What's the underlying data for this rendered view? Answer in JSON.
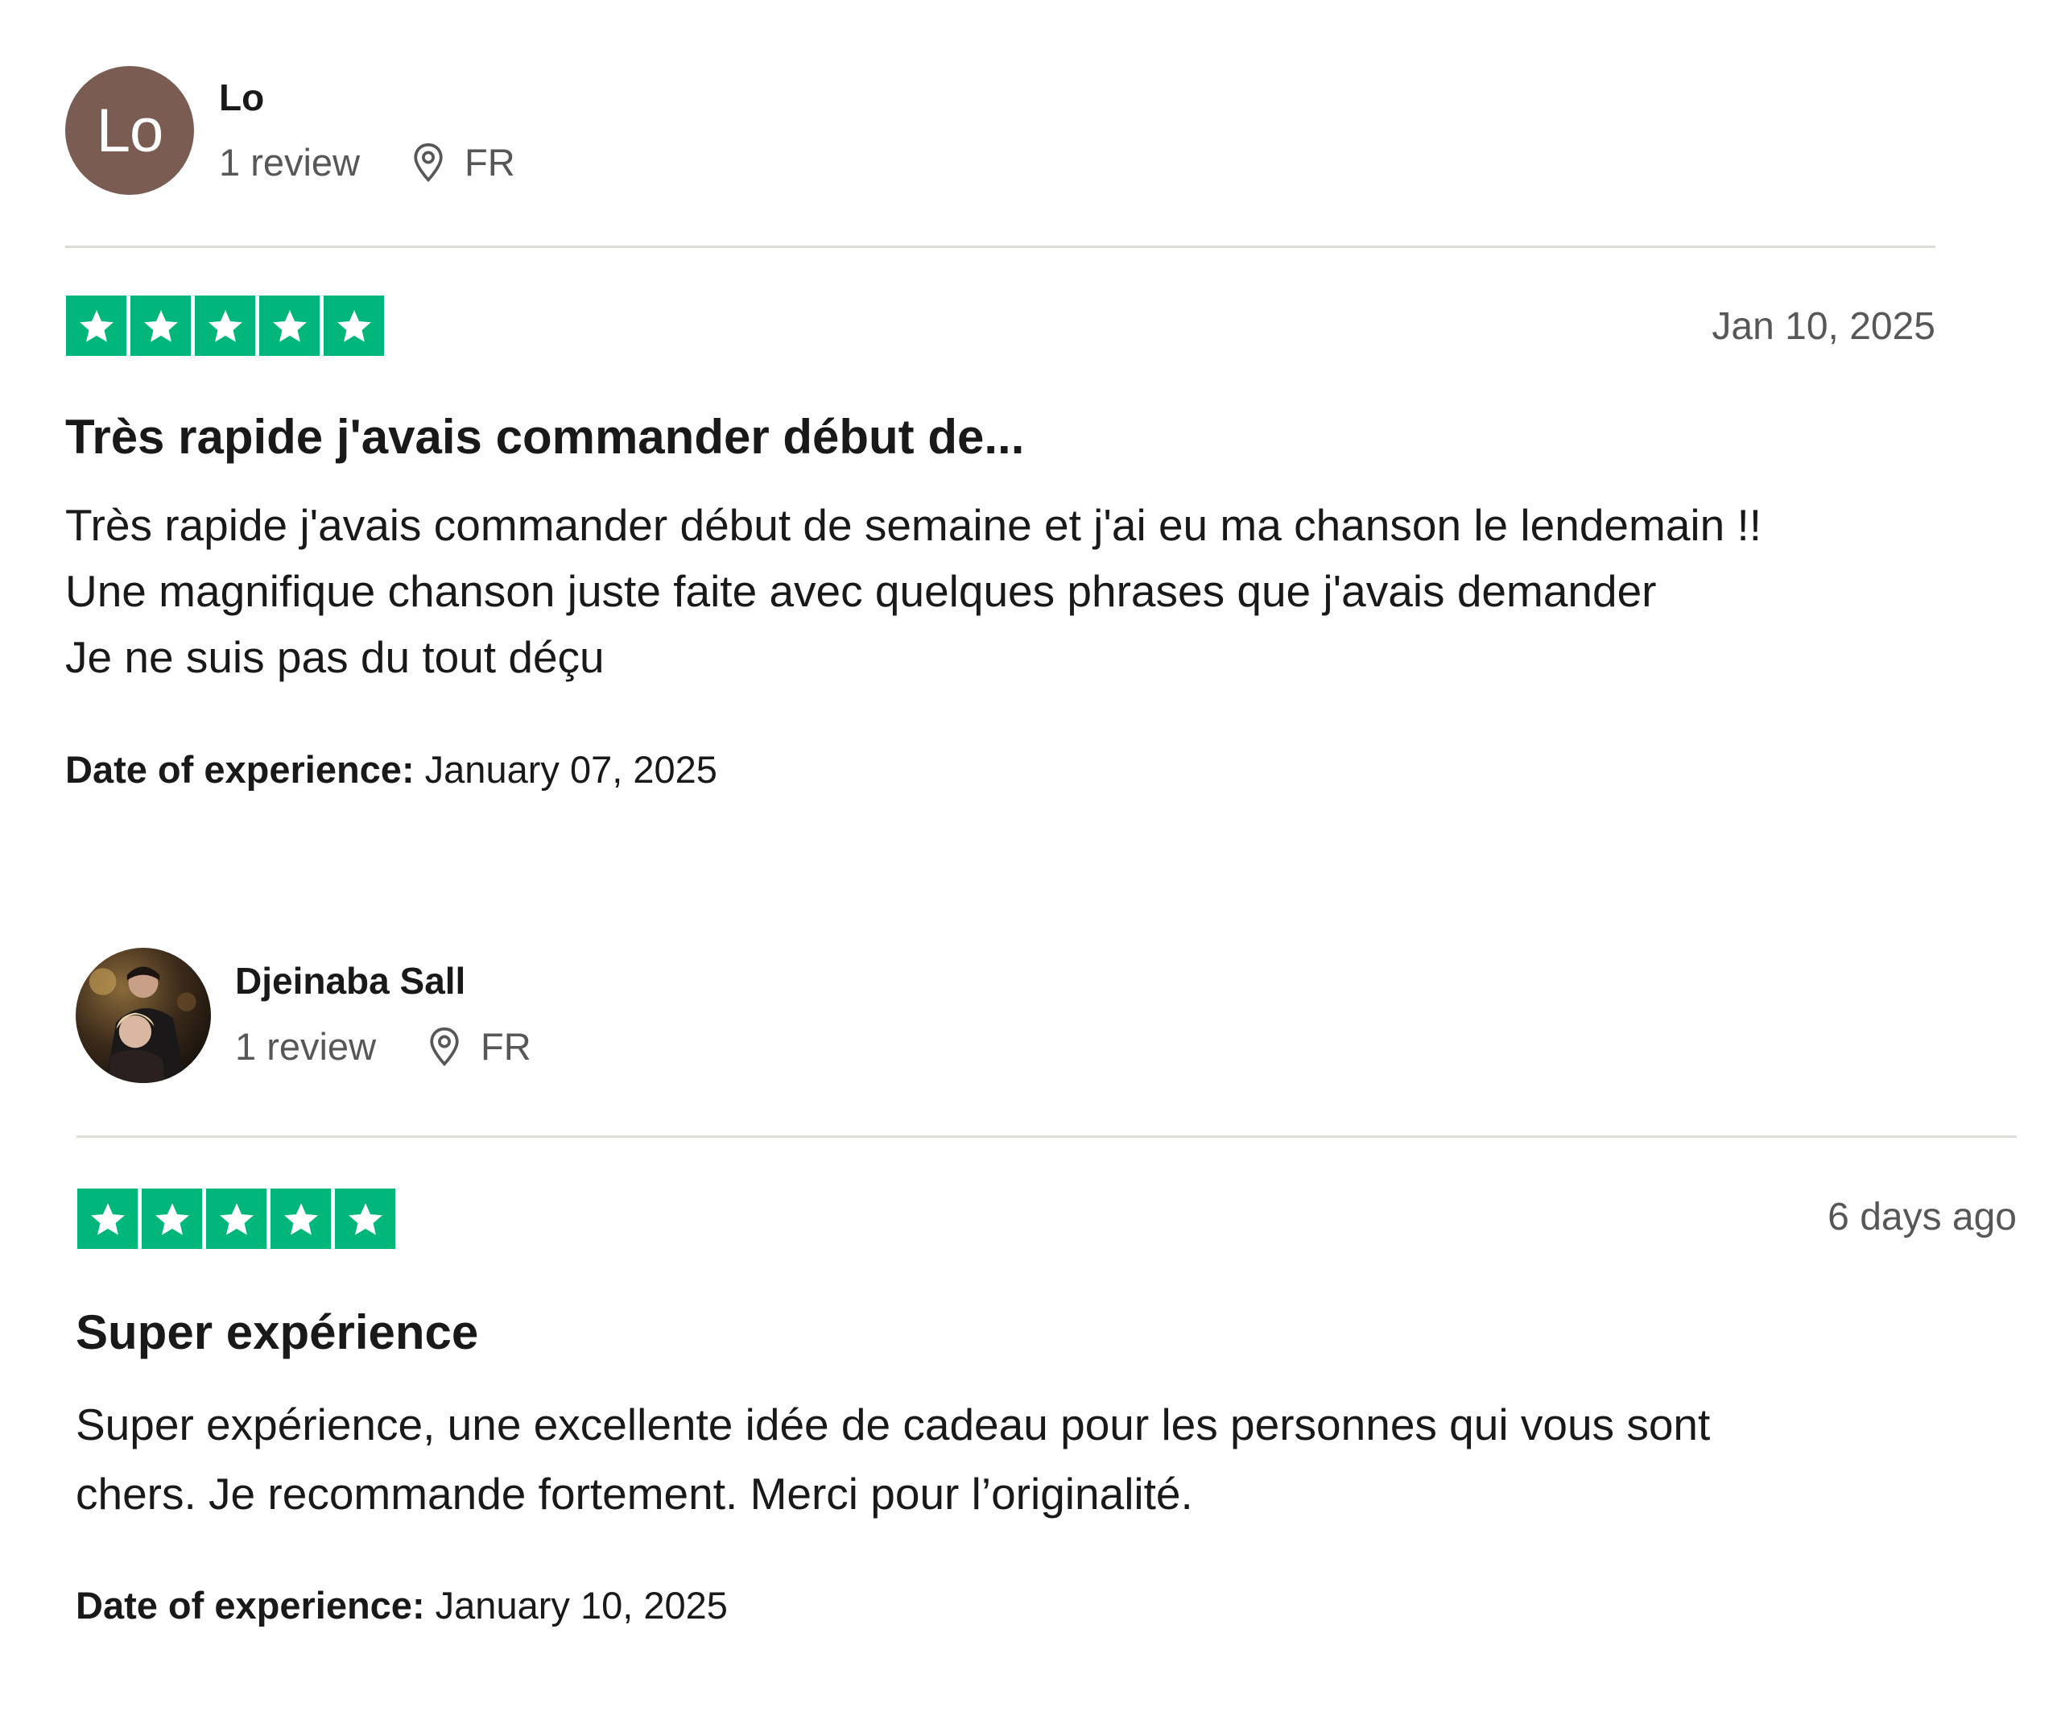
{
  "reviews": [
    {
      "reviewer": {
        "initials": "Lo",
        "name": "Lo",
        "review_count": "1 review",
        "country": "FR",
        "avatar_color": "#7a5c52"
      },
      "rating": 5,
      "date": "Jan 10, 2025",
      "title": "Très rapide j'avais commander début de...",
      "body_lines": [
        "Très rapide j'avais commander début de semaine et j'ai eu ma chanson le lendemain !!",
        "Une magnifique chanson juste faite avec quelques phrases que j'avais demander",
        "Je ne suis pas du tout déçu"
      ],
      "experience_label": "Date of experience:",
      "experience_date": "January 07, 2025"
    },
    {
      "reviewer": {
        "name": "Djeinaba Sall",
        "review_count": "1 review",
        "country": "FR",
        "avatar": "photo"
      },
      "rating": 5,
      "date": "6 days ago",
      "title": "Super expérience",
      "body_lines": [
        "Super expérience, une excellente idée de cadeau pour les personnes qui vous sont",
        "chers. Je recommande fortement. Merci pour l’originalité."
      ],
      "experience_label": "Date of experience:",
      "experience_date": "January 10, 2025"
    }
  ],
  "colors": {
    "star_green": "#00b67a",
    "divider": "#dcdcd6",
    "muted_text": "#575757"
  },
  "icons": {
    "star": "star-icon",
    "location": "location-pin-icon"
  }
}
